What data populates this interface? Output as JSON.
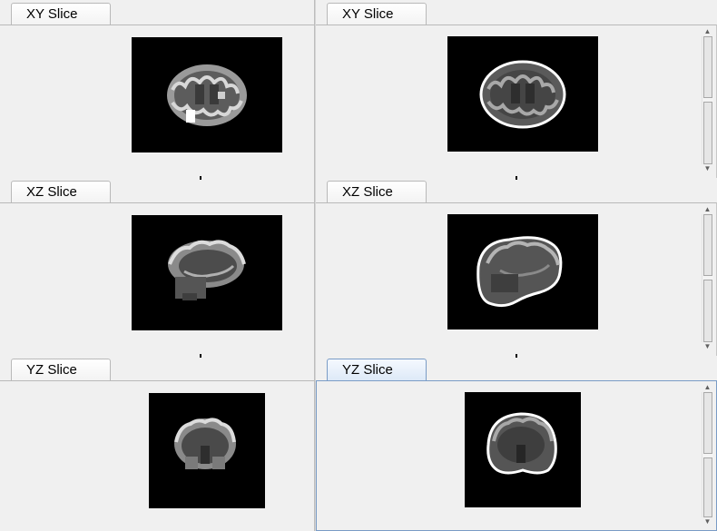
{
  "left_panels": [
    {
      "tab": "XY Slice",
      "slice": "axial"
    },
    {
      "tab": "XZ Slice",
      "slice": "sagittal"
    },
    {
      "tab": "YZ Slice",
      "slice": "coronal"
    }
  ],
  "right_panels": [
    {
      "tab": "XY Slice",
      "slice": "axial",
      "outline": true
    },
    {
      "tab": "XZ Slice",
      "slice": "sagittal",
      "outline": true
    },
    {
      "tab": "YZ Slice",
      "slice": "coronal",
      "outline": true,
      "active": true
    }
  ],
  "colors": {
    "view_bg": "#000000",
    "active_tab_border": "#7a9cc6",
    "brain_gray": "#888888",
    "outline": "#ffffff"
  }
}
